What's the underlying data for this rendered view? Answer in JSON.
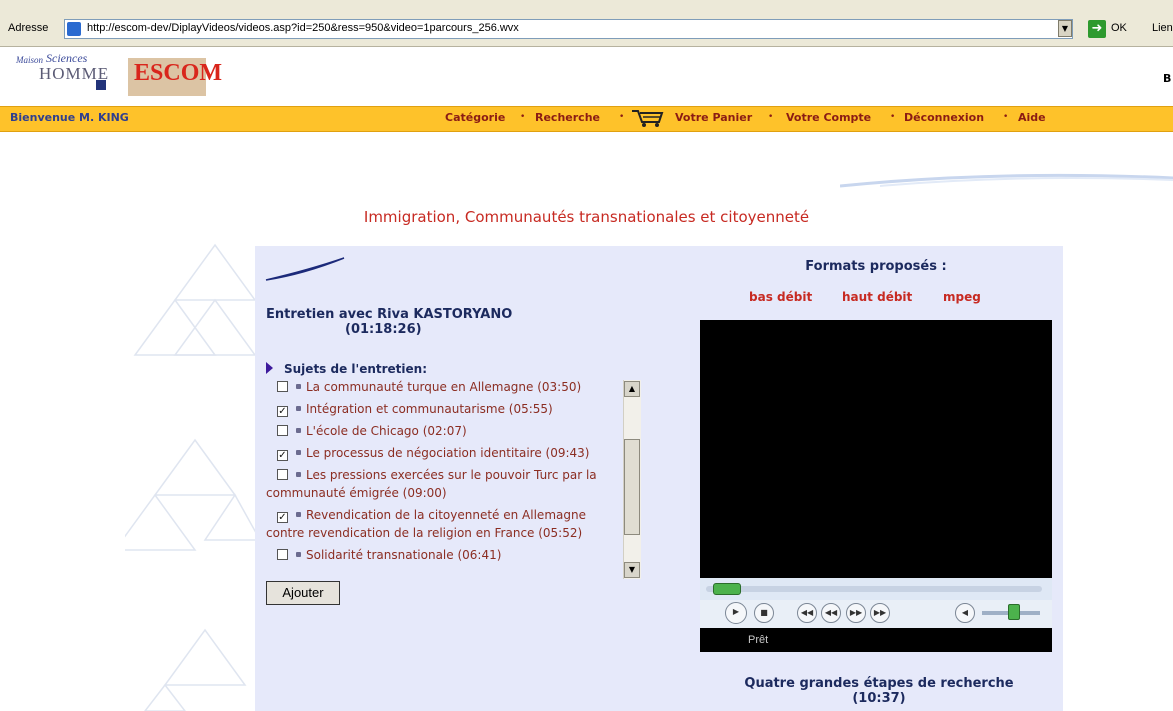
{
  "browser": {
    "address_label": "Adresse",
    "url": "http://escom-dev/DiplayVideos/videos.asp?id=250&ress=950&video=1parcours_256.wvx",
    "go_label": "OK",
    "links_label": "Lien"
  },
  "header": {
    "logo_maison": "Maison",
    "logo_sciences": "Sciences",
    "logo_homme": "HOMME",
    "logo_escom": "ESCOM",
    "corner_text": "B"
  },
  "nav": {
    "welcome": "Bienvenue M. KING",
    "items": [
      "Catégorie",
      "Recherche",
      "Votre Panier",
      "Votre Compte",
      "Déconnexion",
      "Aide"
    ],
    "bullet": "•"
  },
  "page_title": "Immigration, Communautés transnationales et citoyenneté",
  "interview": {
    "title": "Entretien avec Riva KASTORYANO",
    "duration": "(01:18:26)",
    "subjects_label": "Sujets de l'entretien:",
    "subjects": [
      {
        "label": "La communauté turque en Allemagne (03:50)",
        "checked": false
      },
      {
        "label": "Intégration et communautarisme (05:55)",
        "checked": true
      },
      {
        "label": "L'école de Chicago (02:07)",
        "checked": false
      },
      {
        "label": "Le processus de négociation identitaire (09:43)",
        "checked": true
      },
      {
        "label": "Les pressions exercées sur le pouvoir Turc par la communauté émigrée (09:00)",
        "checked": false
      },
      {
        "label": "Revendication de la citoyenneté en Allemagne contre revendication de la religion en France (05:52)",
        "checked": true
      },
      {
        "label": "Solidarité transnationale (06:41)",
        "checked": false
      }
    ],
    "add_button": "Ajouter"
  },
  "formats": {
    "title": "Formats proposés :",
    "options": [
      "bas débit",
      "haut débit",
      "mpeg"
    ]
  },
  "player": {
    "status": "Prêt",
    "progress": 0.05,
    "volume": 0.55
  },
  "next_video": {
    "title": "Quatre grandes étapes de recherche",
    "duration": "(10:37)"
  }
}
